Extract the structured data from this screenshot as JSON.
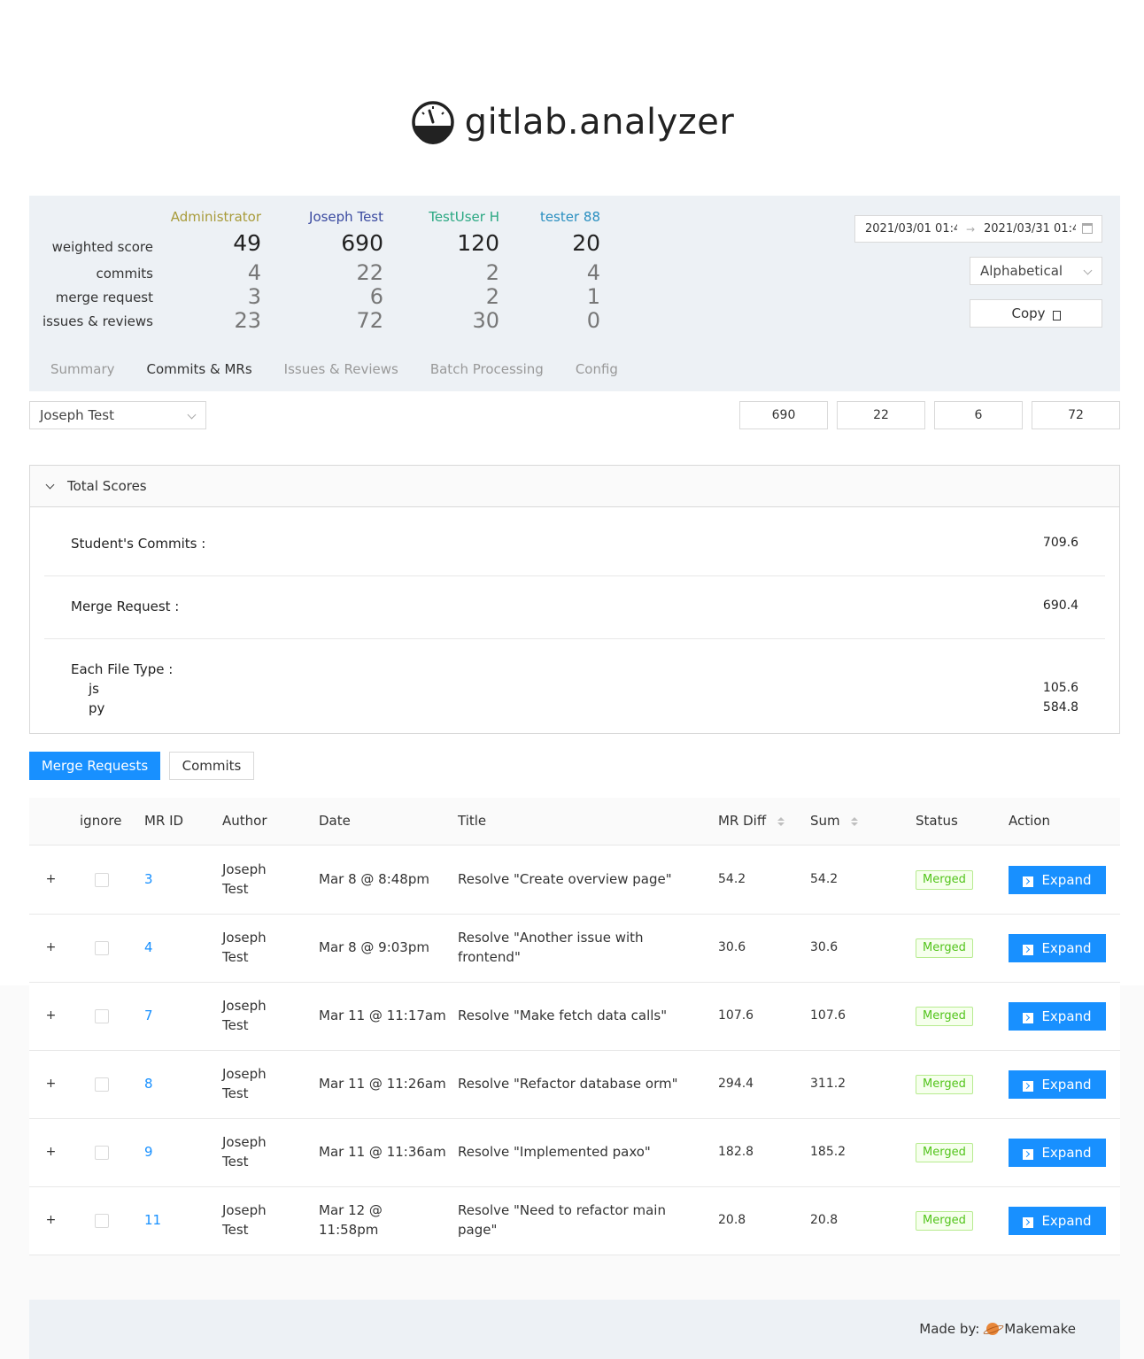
{
  "app": {
    "title": "gitlab.analyzer"
  },
  "header": {
    "users": [
      {
        "name": "Administrator",
        "color": "#a89b3a",
        "weighted_score": "49",
        "commits": "4",
        "merge_requests": "3",
        "issues_reviews": "23"
      },
      {
        "name": "Joseph Test",
        "color": "#3a4aa0",
        "weighted_score": "690",
        "commits": "22",
        "merge_requests": "6",
        "issues_reviews": "72"
      },
      {
        "name": "TestUser H",
        "color": "#2aa882",
        "weighted_score": "120",
        "commits": "2",
        "merge_requests": "2",
        "issues_reviews": "30"
      },
      {
        "name": "tester 88",
        "color": "#2a8fc0",
        "weighted_score": "20",
        "commits": "4",
        "merge_requests": "1",
        "issues_reviews": "0"
      }
    ],
    "row_labels": {
      "weighted_score": "weighted score",
      "commits": "commits",
      "merge_requests": "merge request",
      "issues_reviews": "issues & reviews"
    },
    "date_start": "2021/03/01 01:4",
    "date_end": "2021/03/31 01:4",
    "sort_select": "Alphabetical",
    "copy_label": "Copy"
  },
  "tabs": [
    "Summary",
    "Commits & MRs",
    "Issues & Reviews",
    "Batch Processing",
    "Config"
  ],
  "active_tab": "Commits & MRs",
  "user_select": "Joseph Test",
  "stat_boxes": [
    "690",
    "22",
    "6",
    "72"
  ],
  "total_scores": {
    "title": "Total Scores",
    "students_commits_label": "Student's Commits :",
    "students_commits_value": "709.6",
    "merge_request_label": "Merge Request :",
    "merge_request_value": "690.4",
    "file_type_label": "Each File Type :",
    "file_types": [
      {
        "ext": "js",
        "value": "105.6"
      },
      {
        "ext": "py",
        "value": "584.8"
      }
    ]
  },
  "buttons": {
    "merge_requests": "Merge Requests",
    "commits": "Commits"
  },
  "table": {
    "headers": {
      "ignore": "ignore",
      "mr_id": "MR ID",
      "author": "Author",
      "date": "Date",
      "title": "Title",
      "mr_diff": "MR Diff",
      "sum": "Sum",
      "status": "Status",
      "action": "Action"
    },
    "rows": [
      {
        "id": "3",
        "author1": "Joseph",
        "author2": "Test",
        "date1": "Mar 8 @ 8:48pm",
        "date2": "",
        "title1": "Resolve \"Create overview page\"",
        "title2": "",
        "diff": "54.2",
        "sum": "54.2",
        "status": "Merged",
        "action": "Expand"
      },
      {
        "id": "4",
        "author1": "Joseph",
        "author2": "Test",
        "date1": "Mar 8 @ 9:03pm",
        "date2": "",
        "title1": "Resolve \"Another issue with",
        "title2": "frontend\"",
        "diff": "30.6",
        "sum": "30.6",
        "status": "Merged",
        "action": "Expand"
      },
      {
        "id": "7",
        "author1": "Joseph",
        "author2": "Test",
        "date1": "Mar 11 @ 11:17am",
        "date2": "",
        "title1": "Resolve \"Make fetch data calls\"",
        "title2": "",
        "diff": "107.6",
        "sum": "107.6",
        "status": "Merged",
        "action": "Expand"
      },
      {
        "id": "8",
        "author1": "Joseph",
        "author2": "Test",
        "date1": "Mar 11 @ 11:26am",
        "date2": "",
        "title1": "Resolve \"Refactor database orm\"",
        "title2": "",
        "diff": "294.4",
        "sum": "311.2",
        "status": "Merged",
        "action": "Expand"
      },
      {
        "id": "9",
        "author1": "Joseph",
        "author2": "Test",
        "date1": "Mar 11 @ 11:36am",
        "date2": "",
        "title1": "Resolve \"Implemented paxo\"",
        "title2": "",
        "diff": "182.8",
        "sum": "185.2",
        "status": "Merged",
        "action": "Expand"
      },
      {
        "id": "11",
        "author1": "Joseph",
        "author2": "Test",
        "date1": "Mar 12 @",
        "date2": "11:58pm",
        "title1": "Resolve \"Need to refactor main",
        "title2": "page\"",
        "diff": "20.8",
        "sum": "20.8",
        "status": "Merged",
        "action": "Expand"
      }
    ]
  },
  "footer": {
    "made_by_label": "Made by:",
    "author": "Makemake"
  }
}
